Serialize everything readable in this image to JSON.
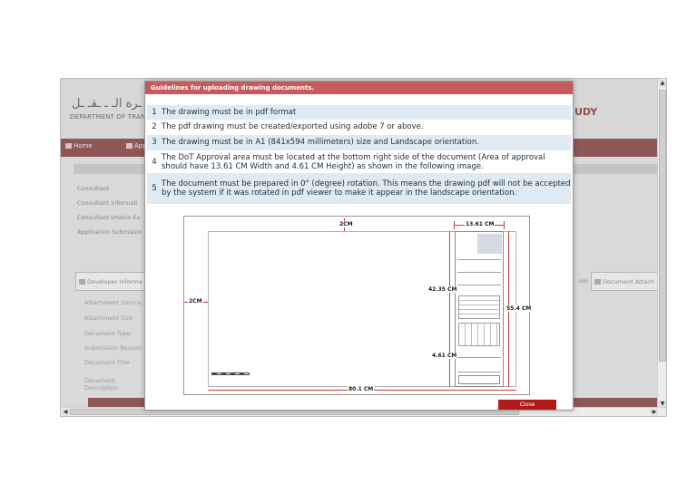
{
  "background_page": {
    "header": {
      "arabic_title": "ـرة الـ ـ ـقـ ـل",
      "english_title": "DEPARTMENT OF TRANSP",
      "right_fragment": "UDY"
    },
    "nav": {
      "home_label": "Home",
      "second_label": "App"
    },
    "side_labels": [
      "Consultant",
      "Consultant Informati",
      "Consultant Unison Ex",
      "Application Submissio"
    ],
    "tabs": {
      "left_tab_label": "Developer Informa",
      "right_tab_lead": "ion",
      "right_tab_label": "Document Attach"
    },
    "attachment_labels": [
      "Attachment Source",
      "Attachment Size",
      "Document Type",
      "Submission Reason",
      "Document Title",
      "Document Description"
    ]
  },
  "modal": {
    "title": "Guidelines for uploading drawing documents.",
    "rules": [
      {
        "num": "1",
        "text": "The drawing must be in pdf format"
      },
      {
        "num": "2",
        "text": "The pdf drawing must be created/exported using adobe 7 or above."
      },
      {
        "num": "3",
        "text": "The drawing must be in A1 (841x594 millimeters) size and Landscape orientation."
      },
      {
        "num": "4",
        "text": "The DoT Approval area must be located at the bottom right side of the document (Area of approval should have 13.61 CM Width and 4.61 CM Height) as shown in the following image."
      },
      {
        "num": "5",
        "text": "The document must be prepared in 0° (degree) rotation. This means the drawing pdf will not be accepted by the system if it was rotated in pdf viewer to make it appear in the landscape orientation."
      }
    ],
    "drawing_labels": {
      "top_margin": "2CM",
      "left_margin": "2CM",
      "approval_width": "13.61 CM",
      "approval_top_height": "42.35 CM",
      "approval_height": "4.61 CM",
      "sheet_height": "55.4 CM",
      "sheet_width": "80.1 CM"
    },
    "close_label": "Close"
  },
  "colors": {
    "modal_title_bg": "#c75a5a",
    "rule_alt_bg": "#dfeaf2",
    "close_button_bg": "#b21a1a",
    "nav_bar_bg": "#8f5757",
    "dimension_lines": "#d23b3b"
  }
}
